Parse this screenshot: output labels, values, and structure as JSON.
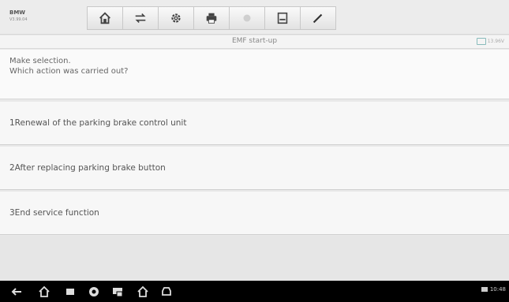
{
  "app": {
    "name": "BMW",
    "version": "V3.99.04"
  },
  "toolbar": {
    "buttons": [
      {
        "name": "home-icon"
      },
      {
        "name": "vehicle-swap-icon"
      },
      {
        "name": "settings-icon"
      },
      {
        "name": "print-icon"
      },
      {
        "name": "help-icon"
      },
      {
        "name": "save-icon"
      },
      {
        "name": "edit-icon"
      }
    ]
  },
  "titlebar": {
    "title": "EMF start-up",
    "indicator": "13.96V"
  },
  "prompt": {
    "line1": "Make selection.",
    "line2": "Which action was carried out?"
  },
  "options": [
    "1Renewal of the parking brake control unit",
    "2After replacing parking brake button",
    "3End service function"
  ],
  "navbar": {
    "time": "10:48"
  },
  "colors": {
    "toolbar_bg": "#ececec",
    "nav_bg": "#000000",
    "row_bg": "#f7f7f7"
  }
}
